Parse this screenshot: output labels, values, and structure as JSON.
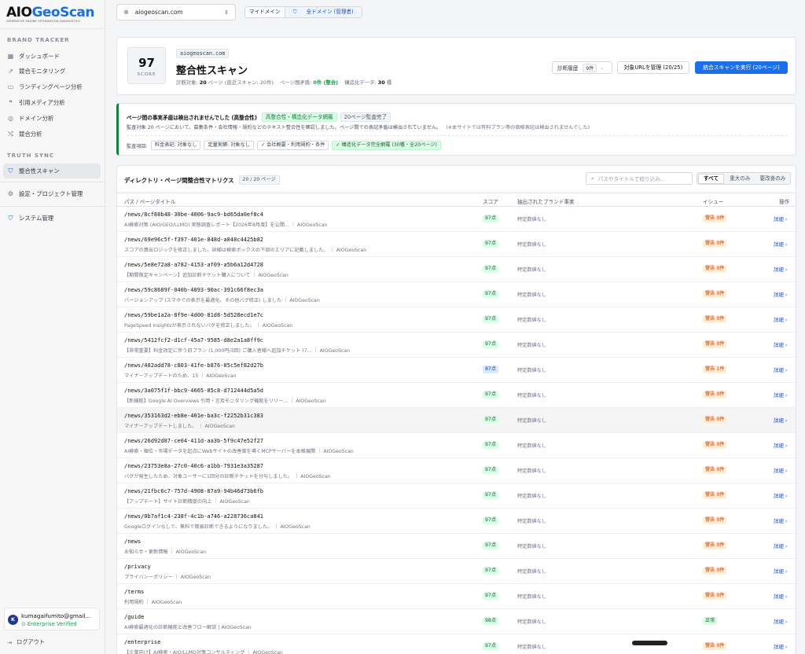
{
  "brand": {
    "logo_a": "AIO",
    "logo_b": "GeoScan",
    "tagline": "GENERATIVE ENGINE OPTIMIZATION DIAGNOSTICS"
  },
  "sidebar": {
    "section1": "BRAND TRACKER",
    "items1": [
      {
        "label": "ダッシュボード",
        "icon": "grid-icon"
      },
      {
        "label": "競合モニタリング",
        "icon": "trend-icon"
      },
      {
        "label": "ランディングページ分析",
        "icon": "monitor-icon"
      },
      {
        "label": "引用メディア分析",
        "icon": "quote-icon"
      },
      {
        "label": "ドメイン分析",
        "icon": "globe-icon"
      },
      {
        "label": "競合分析",
        "icon": "compare-icon"
      }
    ],
    "section2": "TRUTH SYNC",
    "active_item": "整合性スキャン",
    "settings": "設定・プロジェクト管理",
    "system": "システム管理",
    "user_initial": "K",
    "user_email": "kumagaifumito@gmail...",
    "user_plan": "Enterprise Verified",
    "logout": "ログアウト"
  },
  "topbar": {
    "domain": "aiogeoscan.com",
    "scope_mine": "マイドメイン",
    "scope_all": "全ドメイン (管理者)"
  },
  "score_card": {
    "score": "97",
    "score_label": "SCORE",
    "domain": "aiogeoscan.com",
    "title": "整合性スキャン",
    "meta_a": "診断対象:",
    "meta_pages": "20",
    "meta_b": "ページ (直近スキャン: 20件)",
    "meta_c": "ページ間矛盾:",
    "meta_contra": "0件 (整合)",
    "meta_d": "構造化データ:",
    "meta_struct": "30",
    "meta_e": "種",
    "history_label": "診断履歴",
    "history_count": "9件",
    "manage_urls": "対象URLを管理 (20/25)",
    "run_scan": "統合スキャンを実行 (20ページ)"
  },
  "alert": {
    "title": "ページ間の事実矛盾は検出されませんでした (高整合性)",
    "tag1": "高整合性・構造化データ網羅",
    "tag2": "20ページ監査完了",
    "desc": "監査対象 20 ページにおいて、募集条件・会社情報・規約などのテキスト整合性を確認しました。ページ間での表記矛盾は検出されていません。",
    "note": "(※本サイトでは有料プラン等の価格表記は検出されませんでした)",
    "items_label": "監査項目:",
    "chip1": "料金表記: 対象なし",
    "chip2": "定量実績: 対象なし",
    "chip3": "✓ 会社概要・利用規約・条件",
    "chip4": "✓ 構造化データ完全網羅 (30種・全20ページ)"
  },
  "matrix": {
    "title": "ディレクトリ・ページ間整合性マトリクス",
    "count": "20 / 20 ページ",
    "search_placeholder": "パスやタイトルで絞り込み...",
    "filter_all": "すべて",
    "filter_major": "重大のみ",
    "filter_improve": "要改善のみ",
    "col_path": "パス / ページタイトル",
    "col_score": "スコア",
    "col_facts": "抽出されたブランド事実",
    "col_issue": "イシュー",
    "col_action": "操作",
    "rows": [
      {
        "path": "/news/8cf88b48-30be-4006-9ac9-bd65da0ef8c4",
        "title": "AI検索対策 (AIO/GEO/LLMO) 実態調査レポート【2026年8月度】を公開... ｜ AIOGeoScan",
        "score": "97点",
        "facts": "特定数値なし",
        "issue": "警告 0件",
        "detail": "詳細 ›"
      },
      {
        "path": "/news/69e96c5f-f397-401e-848d-a848c4425b82",
        "title": "スコアの算出ロジックを修正しました。詳細は検索ボックスの下部のエリアに記載しました。 ｜ AIOGeoScan",
        "score": "97点",
        "facts": "特定数値なし",
        "issue": "警告 0件",
        "detail": "詳細 ›"
      },
      {
        "path": "/news/5e8e72a8-a782-4153-af09-a5b6a12d4728",
        "title": "【期間限定キャンペーン】追加診断チケット購入について ｜ AIOGeoScan",
        "score": "97点",
        "facts": "特定数値なし",
        "issue": "警告 0件",
        "detail": "詳細 ›"
      },
      {
        "path": "/news/59c8689f-040b-4093-90ac-391c66f8ec3a",
        "title": "バージョンアップ (スマホでの表示を最適化、その他バグ修正) しました ｜ AIOGeoScan",
        "score": "97点",
        "facts": "特定数値なし",
        "issue": "警告 0件",
        "detail": "詳細 ›"
      },
      {
        "path": "/news/59be1a2a-8f9e-4d00-81d8-5d528ecd1e7c",
        "title": "PageSpeed Insightsが表示されないバグを修正しました。 ｜ AIOGeoScan",
        "score": "97点",
        "facts": "特定数値なし",
        "issue": "警告 0件",
        "detail": "詳細 ›"
      },
      {
        "path": "/news/5412fcf2-d1cf-45a7-9585-d8e2a1a8ff9c",
        "title": "【非常重要】料金改定に伴う旧プラン (1,000円/3回) ご購入者様へ追加チケット (7... ｜ AIOGeoScan",
        "score": "97点",
        "facts": "特定数値なし",
        "issue": "警告 0件",
        "detail": "詳細 ›"
      },
      {
        "path": "/news/482add78-c803-41fe-b876-05c5ef82d27b",
        "title": "マイナーアップデートのため、15 ｜ AIOGeoScan",
        "score": "87点",
        "score_blue": true,
        "facts": "特定数値なし",
        "issue": "警告 1件",
        "detail": "詳細 ›"
      },
      {
        "path": "/news/3a075f1f-bbc9-4665-85c8-d712444d5a5d",
        "title": "【新機能】Google AI Overviews 引用・言及モニタリング機能をリリー... ｜ AIOGeoScan",
        "score": "97点",
        "facts": "特定数値なし",
        "issue": "警告 0件",
        "detail": "詳細 ›"
      },
      {
        "path": "/news/353163d2-eb8e-401e-ba3c-f2252b31c383",
        "title": "マイナーアップデートしました。 ｜ AIOGeoScan",
        "score": "97点",
        "facts": "特定数値なし",
        "issue": "警告 0件",
        "detail": "詳細 ›",
        "hl": true
      },
      {
        "path": "/news/26d92d87-ce04-411d-aa3b-5f9c47e52f27",
        "title": "AI検索・順位・市場データを起点にWebサイトの改善案を導くMCPサーバーを本格展開 ｜ AIOGeoScan",
        "score": "97点",
        "facts": "特定数値なし",
        "issue": "警告 0件",
        "detail": "詳細 ›"
      },
      {
        "path": "/news/23753e8a-27c0-40c6-a1bb-7931e3a35287",
        "title": "バグが発生したため、対象ユーザーに1回分の診断チケットを付与しました。 ｜ AIOGeoScan",
        "score": "97点",
        "facts": "特定数値なし",
        "issue": "警告 0件",
        "detail": "詳細 ›"
      },
      {
        "path": "/news/21fbc6c7-757d-4908-87a9-94b46d73b6fb",
        "title": "【アップデート】サイト診断精度の向上 ｜ AIOGeoScan",
        "score": "97点",
        "facts": "特定数値なし",
        "issue": "警告 0件",
        "detail": "詳細 ›"
      },
      {
        "path": "/news/0b7af1c4-238f-4c1b-a746-a228736ca841",
        "title": "Googleログインなしで、無料で簡易診断できるようになりました。 ｜ AIOGeoScan",
        "score": "97点",
        "facts": "特定数値なし",
        "issue": "警告 0件",
        "detail": "詳細 ›"
      },
      {
        "path": "/news",
        "title": "お知らせ・更新情報 ｜ AIOGeoScan",
        "score": "97点",
        "facts": "特定数値なし",
        "issue": "警告 0件",
        "detail": "詳細 ›"
      },
      {
        "path": "/privacy",
        "title": "プライバシーポリシー ｜ AIOGeoScan",
        "score": "97点",
        "facts": "特定数値なし",
        "issue": "警告 0件",
        "detail": "詳細 ›"
      },
      {
        "path": "/terms",
        "title": "利用規約 ｜ AIOGeoScan",
        "score": "97点",
        "facts": "特定数値なし",
        "issue": "警告 0件",
        "detail": "詳細 ›"
      },
      {
        "path": "/guide",
        "title": "AI検索最適化の診断機能と改善フロー解説 | AIOGeoScan",
        "score": "98点",
        "facts": "特定数値なし",
        "issue": "正常",
        "issue_ok": true,
        "detail": "詳細 ›"
      },
      {
        "path": "/enterprise",
        "title": "【企業向け】AI検索・AIO/LLMO対策コンサルティング ｜ AIOGeoScan",
        "score": "97点",
        "facts": "特定数値なし",
        "issue": "警告 0件",
        "detail": "詳細 ›"
      }
    ]
  }
}
